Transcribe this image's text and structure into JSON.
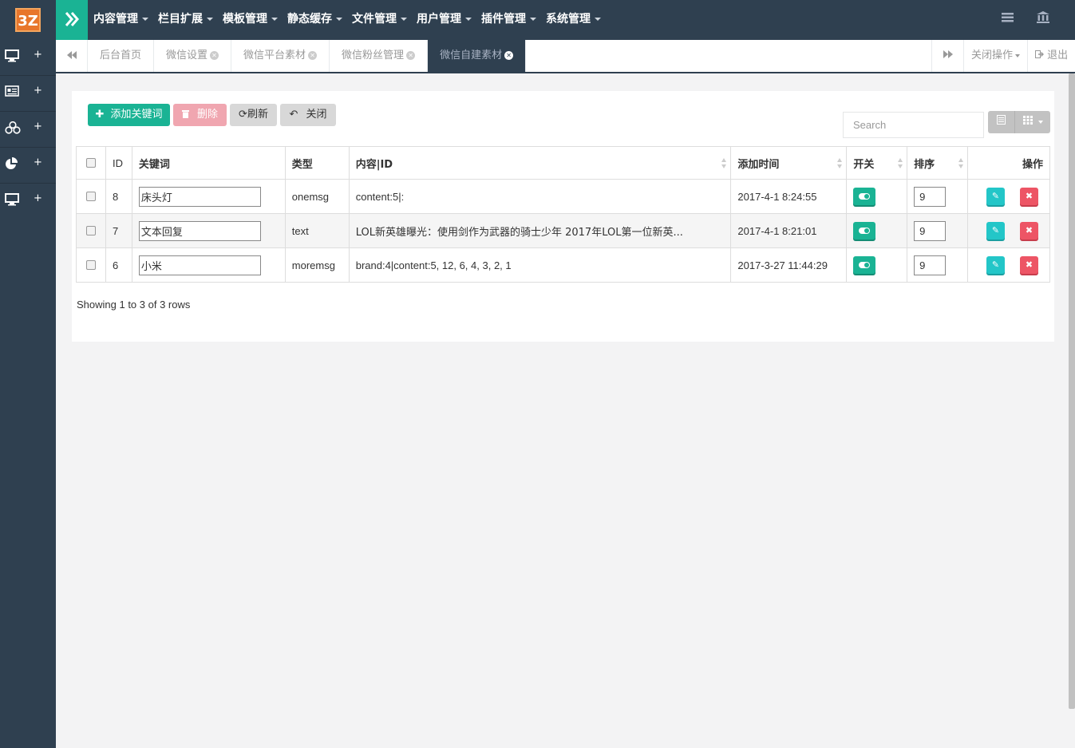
{
  "app": {
    "logo_text": "3Z",
    "top_menu": [
      "内容管理",
      "栏目扩展",
      "模板管理",
      "静态缓存",
      "文件管理",
      "用户管理",
      "插件管理",
      "系统管理"
    ],
    "sidebar_plus": "+"
  },
  "tabs": {
    "items": [
      {
        "label": "后台首页",
        "closable": false
      },
      {
        "label": "微信设置",
        "closable": true
      },
      {
        "label": "微信平台素材",
        "closable": true
      },
      {
        "label": "微信粉丝管理",
        "closable": true
      },
      {
        "label": "微信自建素材",
        "closable": true,
        "active": true
      }
    ],
    "close_ops": "关闭操作",
    "logout": "退出"
  },
  "toolbar": {
    "add": "添加关键词",
    "delete": "删除",
    "refresh": "刷新",
    "close": "关闭",
    "search_placeholder": "Search"
  },
  "table": {
    "headers": [
      "ID",
      "关键词",
      "类型",
      "内容|ID",
      "添加时间",
      "开关",
      "排序",
      "操作"
    ],
    "rows": [
      {
        "id": "8",
        "keyword": "床头灯",
        "type": "onemsg",
        "content": "content:5|:",
        "time": "2017-4-1 8:24:55",
        "order": "9"
      },
      {
        "id": "7",
        "keyword": "文本回复",
        "type": "text",
        "content": "LOL新英雄曝光：使用剑作为武器的骑士少年 2017年LOL第一位新英...",
        "time": "2017-4-1 8:21:01",
        "order": "9"
      },
      {
        "id": "6",
        "keyword": "小米",
        "type": "moremsg",
        "content": "brand:4|content:5, 12, 6, 4, 3, 2, 1",
        "time": "2017-3-27 11:44:29",
        "order": "9"
      }
    ],
    "footer": "Showing 1 to 3 of 3 rows"
  },
  "colors": {
    "navy": "#2f4050",
    "green": "#1ab394",
    "cyan": "#23c6c8",
    "red": "#ed5565"
  }
}
